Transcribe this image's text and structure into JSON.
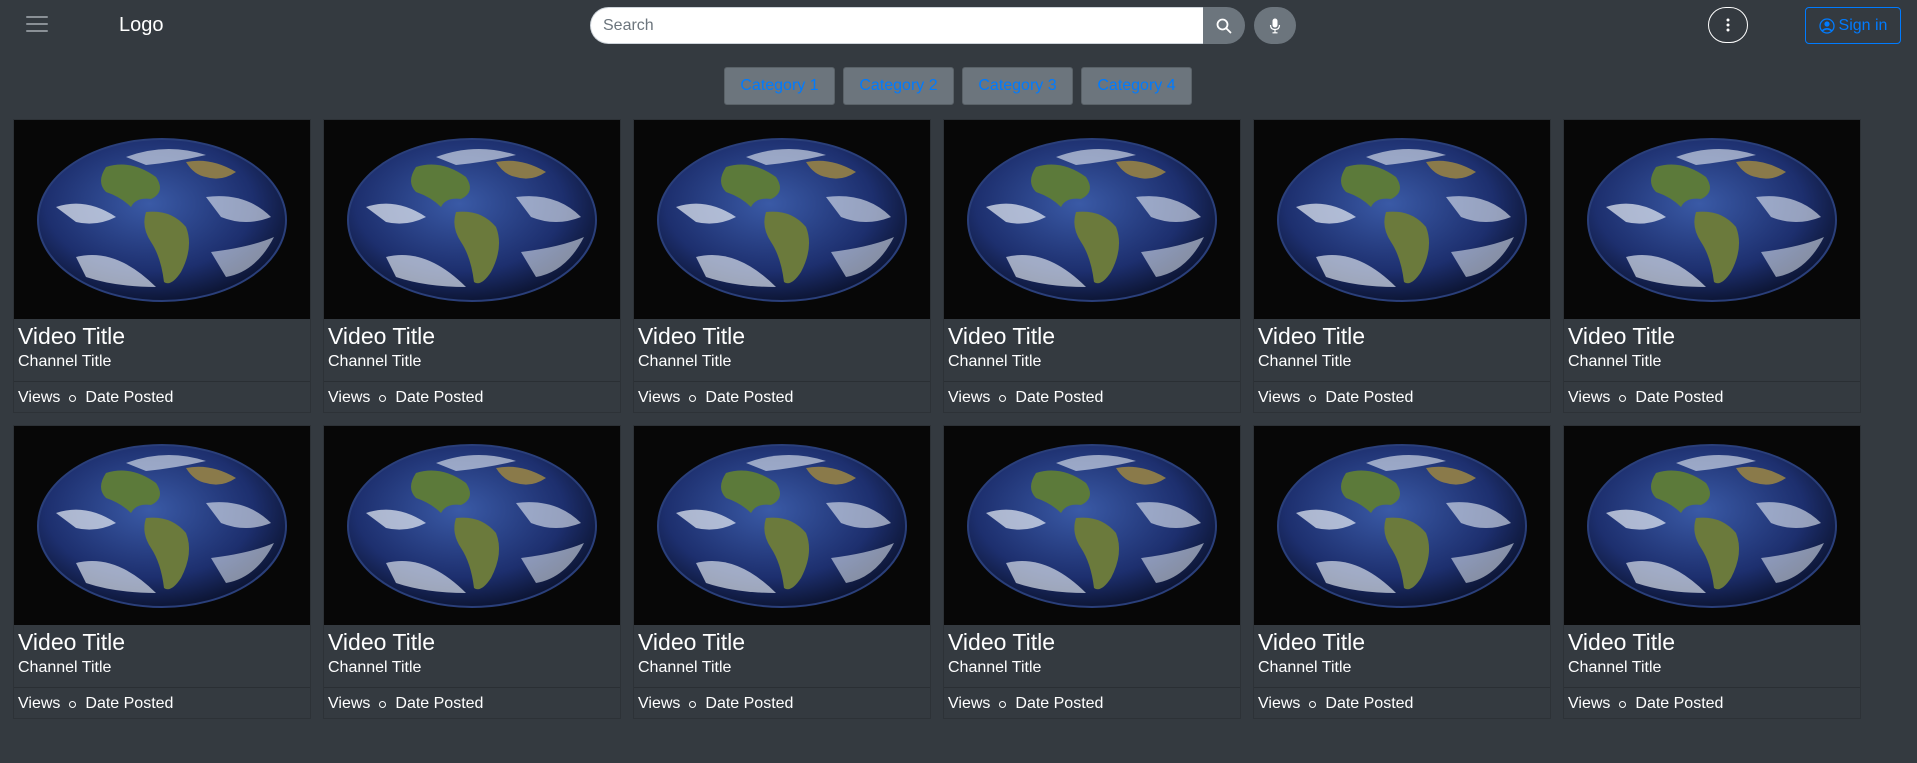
{
  "header": {
    "menu_icon": "hamburger-menu-icon",
    "logo": "Logo",
    "search_placeholder": "Search",
    "search_icon": "search-icon",
    "mic_icon": "microphone-icon",
    "more_icon": "vertical-dots-icon",
    "sign_in_label": "Sign in",
    "sign_in_icon": "user-circle-icon"
  },
  "categories": [
    "Category 1",
    "Category 2",
    "Category 3",
    "Category 4"
  ],
  "videos": [
    {
      "title": "Video Title",
      "channel": "Channel Title",
      "views": "Views",
      "date": "Date Posted"
    },
    {
      "title": "Video Title",
      "channel": "Channel Title",
      "views": "Views",
      "date": "Date Posted"
    },
    {
      "title": "Video Title",
      "channel": "Channel Title",
      "views": "Views",
      "date": "Date Posted"
    },
    {
      "title": "Video Title",
      "channel": "Channel Title",
      "views": "Views",
      "date": "Date Posted"
    },
    {
      "title": "Video Title",
      "channel": "Channel Title",
      "views": "Views",
      "date": "Date Posted"
    },
    {
      "title": "Video Title",
      "channel": "Channel Title",
      "views": "Views",
      "date": "Date Posted"
    },
    {
      "title": "Video Title",
      "channel": "Channel Title",
      "views": "Views",
      "date": "Date Posted"
    },
    {
      "title": "Video Title",
      "channel": "Channel Title",
      "views": "Views",
      "date": "Date Posted"
    },
    {
      "title": "Video Title",
      "channel": "Channel Title",
      "views": "Views",
      "date": "Date Posted"
    },
    {
      "title": "Video Title",
      "channel": "Channel Title",
      "views": "Views",
      "date": "Date Posted"
    },
    {
      "title": "Video Title",
      "channel": "Channel Title",
      "views": "Views",
      "date": "Date Posted"
    },
    {
      "title": "Video Title",
      "channel": "Channel Title",
      "views": "Views",
      "date": "Date Posted"
    }
  ],
  "colors": {
    "background": "#343a40",
    "accent": "#007bff",
    "secondary": "#6c757d"
  }
}
